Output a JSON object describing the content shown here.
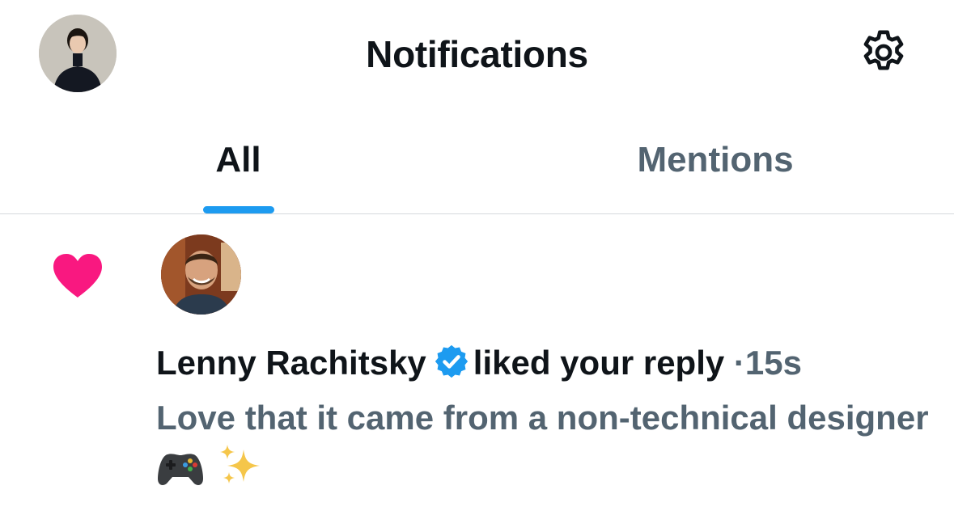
{
  "header": {
    "title": "Notifications",
    "profile_avatar_icon": "user-avatar",
    "settings_icon": "gear-icon"
  },
  "tabs": [
    {
      "label": "All",
      "selected": true
    },
    {
      "label": "Mentions",
      "selected": false
    }
  ],
  "colors": {
    "accent": "#1d9bf0",
    "like": "#f91880",
    "secondary_text": "#536471",
    "primary_text": "#0f1419"
  },
  "notifications": [
    {
      "type_icon": "heart-icon",
      "actor_name": "Lenny Rachitsky",
      "verified": true,
      "action": "liked your reply",
      "separator": "·",
      "time": "15s",
      "reply_text": "Love that it came from a non-technical designer",
      "reply_emojis": [
        "game-controller-icon",
        "sparkles-icon"
      ]
    }
  ]
}
